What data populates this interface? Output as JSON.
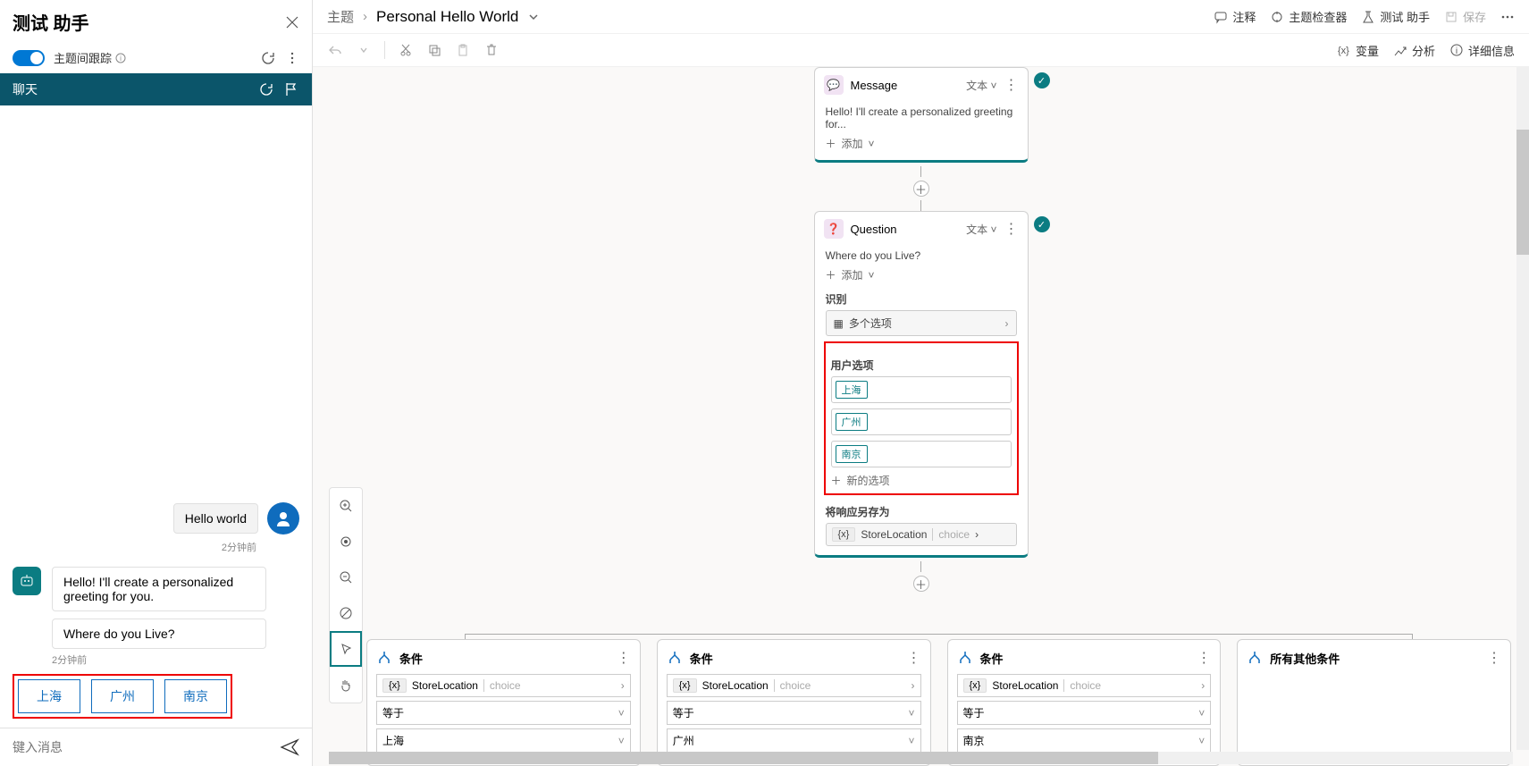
{
  "test_panel": {
    "title": "测试 助手",
    "track_label": "主题间跟踪",
    "tab_chat": "聊天",
    "user_msg": "Hello world",
    "time1": "2分钟前",
    "bot_msg1": "Hello! I'll create a personalized greeting for you.",
    "bot_msg2": "Where do you Live?",
    "time2": "2分钟前",
    "choices": [
      "上海",
      "广州",
      "南京"
    ],
    "input_placeholder": "键入消息"
  },
  "breadcrumb": {
    "root": "主题",
    "current": "Personal Hello World"
  },
  "header_buttons": {
    "comment": "注释",
    "checker": "主题检查器",
    "test": "测试 助手",
    "save": "保存"
  },
  "toolbar_right": {
    "vars": "变量",
    "analyze": "分析",
    "details": "详细信息"
  },
  "node_message": {
    "title": "Message",
    "type": "文本",
    "body": "Hello! I'll create a personalized greeting for...",
    "add": "添加"
  },
  "node_question": {
    "title": "Question",
    "type": "文本",
    "body": "Where do you Live?",
    "add": "添加",
    "identify_label": "识别",
    "multi_option": "多个选项",
    "user_options_label": "用户选项",
    "options": [
      "上海",
      "广州",
      "南京"
    ],
    "new_option": "新的选项",
    "save_as_label": "将响应另存为",
    "var_name": "StoreLocation",
    "var_type": "choice"
  },
  "branches": {
    "condition_title": "条件",
    "other_title": "所有其他条件",
    "var_name": "StoreLocation",
    "var_type": "choice",
    "eq": "等于",
    "vals": [
      "上海",
      "广州",
      "南京"
    ]
  }
}
